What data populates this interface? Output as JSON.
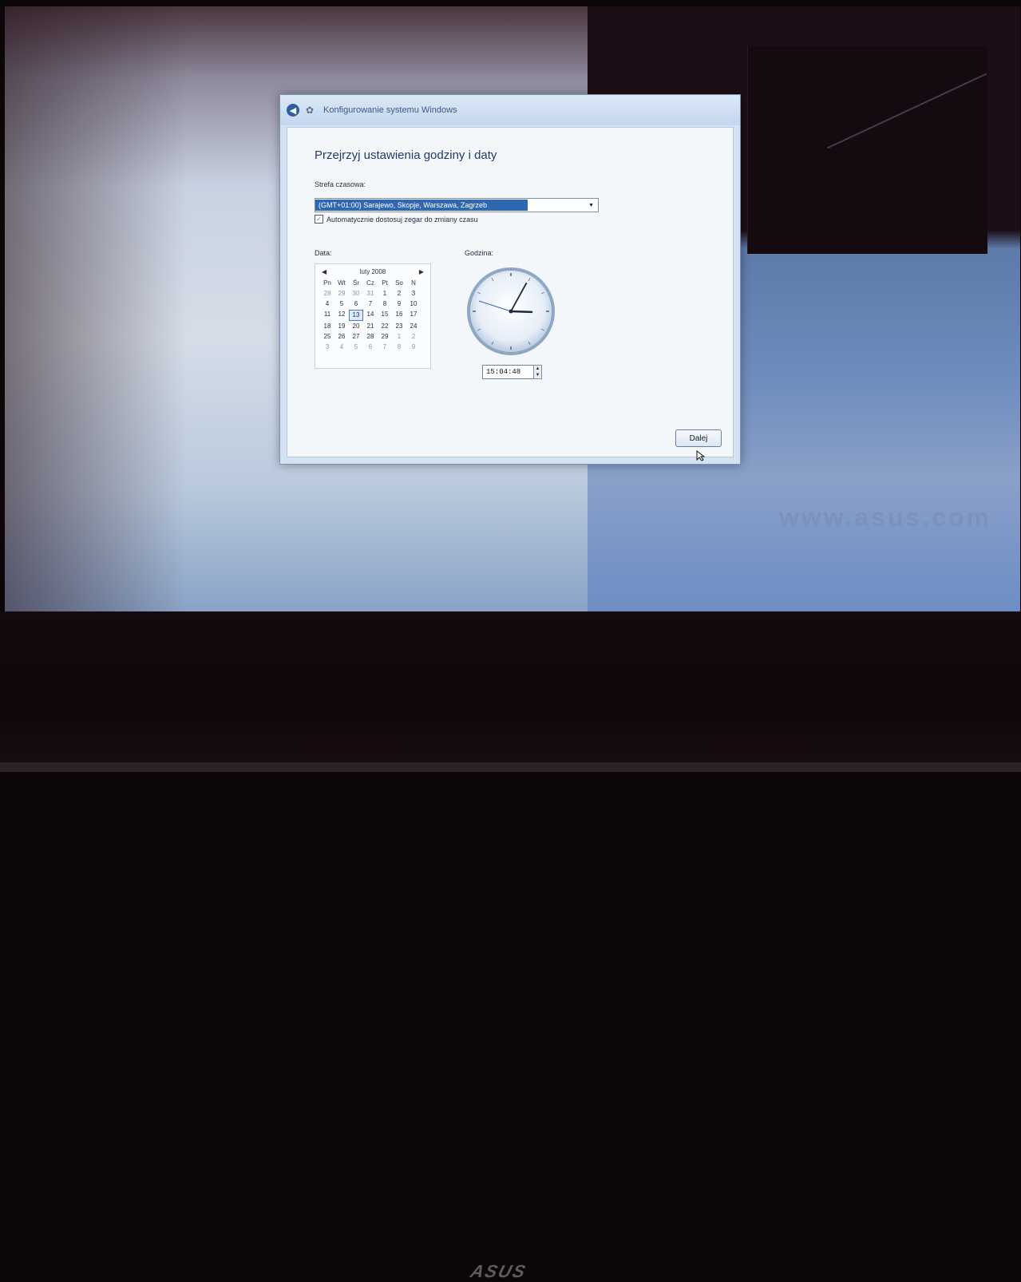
{
  "dialog": {
    "title": "Konfigurowanie systemu Windows",
    "page_title": "Przejrzyj ustawienia godziny i daty",
    "timezone_label": "Strefa czasowa:",
    "timezone_value": "(GMT+01:00) Sarajewo, Skopje, Warszawa, Zagrzeb",
    "dst_checkbox_label": "Automatycznie dostosuj zegar do zmiany czasu",
    "dst_checked": true,
    "date_label": "Data:",
    "time_label": "Godzina:",
    "time_value": "15:04:48",
    "next_button": "Dalej"
  },
  "calendar": {
    "month_label": "luty 2008",
    "weekdays": [
      "Pn",
      "Wt",
      "Śr",
      "Cz",
      "Pt",
      "So",
      "N"
    ],
    "days": [
      "28",
      "29",
      "30",
      "31",
      "1",
      "2",
      "3",
      "4",
      "5",
      "6",
      "7",
      "8",
      "9",
      "10",
      "11",
      "12",
      "13",
      "14",
      "15",
      "16",
      "17",
      "18",
      "19",
      "20",
      "21",
      "22",
      "23",
      "24",
      "25",
      "26",
      "27",
      "28",
      "29",
      "1",
      "2",
      "3",
      "4",
      "5",
      "6",
      "7",
      "8",
      "9"
    ],
    "selected_day": "13"
  },
  "screen": {
    "brand_url": "www.asus.com"
  },
  "bezel": {
    "logo": "ASUS"
  }
}
